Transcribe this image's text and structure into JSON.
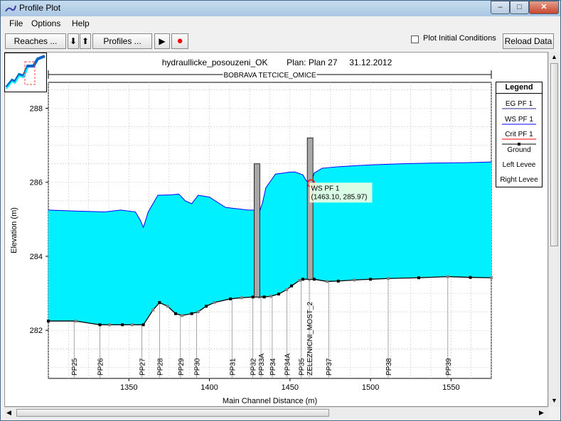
{
  "window": {
    "title": "Profile Plot"
  },
  "menu": {
    "file": "File",
    "options": "Options",
    "help": "Help"
  },
  "toolbar": {
    "reaches_label": "Reaches ...",
    "down_arrow": "⬇",
    "up_arrow": "⬆",
    "profiles_label": "Profiles ...",
    "play_glyph": "▶",
    "record_glyph": "●",
    "plot_initial_label": "Plot Initial Conditions",
    "plot_initial_checked": false,
    "reload_label": "Reload Data"
  },
  "legend": {
    "title": "Legend",
    "items": [
      "EG  PF 1",
      "WS  PF 1",
      "Crit  PF 1",
      "Ground",
      "Left Levee",
      "Right Levee"
    ]
  },
  "tooltip": {
    "line1": "WS  PF 1",
    "line2": "(1463.10, 285.97)"
  },
  "colors": {
    "water": "#00f0ff",
    "ground": "#000000",
    "bridge": "#a8a8a8",
    "grid": "#c8c8c8",
    "record": "#ff0000"
  },
  "chart_data": {
    "type": "area",
    "title": "hydraullicke_posouzeni_OK        Plan: Plan 27     31.12.2012",
    "subtitle": "BOBRAVA TETCICE_OMICE",
    "xlabel": "Main Channel Distance (m)",
    "ylabel": "Elevation (m)",
    "xlim": [
      1300,
      1575
    ],
    "ylim": [
      280.7,
      288.7
    ],
    "x_ticks": [
      1350,
      1400,
      1450,
      1500,
      1550
    ],
    "y_ticks": [
      282,
      284,
      286,
      288
    ],
    "grid": true,
    "legend_position": "right",
    "series": [
      {
        "name": "WS  PF 1",
        "x": [
          1300,
          1318,
          1335,
          1345,
          1354,
          1357,
          1359,
          1362,
          1368,
          1376,
          1381,
          1385,
          1389,
          1393,
          1400,
          1410,
          1418,
          1424,
          1427,
          1429,
          1431,
          1433,
          1435,
          1441,
          1446,
          1449,
          1453,
          1458,
          1460,
          1461.5,
          1463.1,
          1465,
          1470,
          1480,
          1500,
          1520,
          1540,
          1560,
          1575
        ],
        "y": [
          285.25,
          285.22,
          285.2,
          285.25,
          285.2,
          284.98,
          284.78,
          285.2,
          285.65,
          285.66,
          285.68,
          285.5,
          285.42,
          285.65,
          285.6,
          285.32,
          285.28,
          285.25,
          285.25,
          285.22,
          285.2,
          285.45,
          285.85,
          286.22,
          286.25,
          286.27,
          286.28,
          286.2,
          286.05,
          286.0,
          285.97,
          286.25,
          286.38,
          286.42,
          286.47,
          286.5,
          286.52,
          286.53,
          286.55
        ]
      },
      {
        "name": "Ground",
        "x": [
          1300,
          1317,
          1332,
          1338,
          1346,
          1352,
          1359,
          1365,
          1369,
          1374,
          1379,
          1383,
          1389,
          1393,
          1398,
          1403,
          1413,
          1420,
          1427,
          1431,
          1434,
          1438,
          1443,
          1448,
          1451,
          1456,
          1458,
          1462,
          1465,
          1473,
          1480,
          1490,
          1500,
          1511,
          1530,
          1548,
          1562,
          1575
        ],
        "y": [
          282.25,
          282.25,
          282.15,
          282.15,
          282.15,
          282.15,
          282.15,
          282.55,
          282.75,
          282.65,
          282.45,
          282.4,
          282.45,
          282.5,
          282.65,
          282.75,
          282.85,
          282.88,
          282.9,
          282.9,
          282.9,
          282.92,
          282.98,
          283.1,
          283.2,
          283.35,
          283.38,
          283.38,
          283.38,
          283.32,
          283.33,
          283.36,
          283.38,
          283.4,
          283.42,
          283.45,
          283.43,
          283.42
        ]
      }
    ],
    "bridges": [
      {
        "x": 1429.5,
        "top": 286.5,
        "bottom": 282.9
      },
      {
        "x": 1462.5,
        "top": 287.2,
        "bottom": 283.38
      }
    ],
    "stations": [
      {
        "label": "PP25",
        "x": 1316
      },
      {
        "label": "PP26",
        "x": 1332
      },
      {
        "label": "PP27",
        "x": 1358
      },
      {
        "label": "PP28",
        "x": 1369
      },
      {
        "label": "PP29",
        "x": 1382
      },
      {
        "label": "PP30",
        "x": 1392
      },
      {
        "label": "PP31",
        "x": 1414
      },
      {
        "label": "PP32",
        "x": 1427
      },
      {
        "label": "PP33A",
        "x": 1432
      },
      {
        "label": "PP34",
        "x": 1439
      },
      {
        "label": "PP34A",
        "x": 1448
      },
      {
        "label": "PP35",
        "x": 1457
      },
      {
        "label": "ZELEZNICNI_MOST_2",
        "x": 1462
      },
      {
        "label": "PP37",
        "x": 1474
      },
      {
        "label": "PP38",
        "x": 1511
      },
      {
        "label": "PP39",
        "x": 1548
      }
    ]
  }
}
